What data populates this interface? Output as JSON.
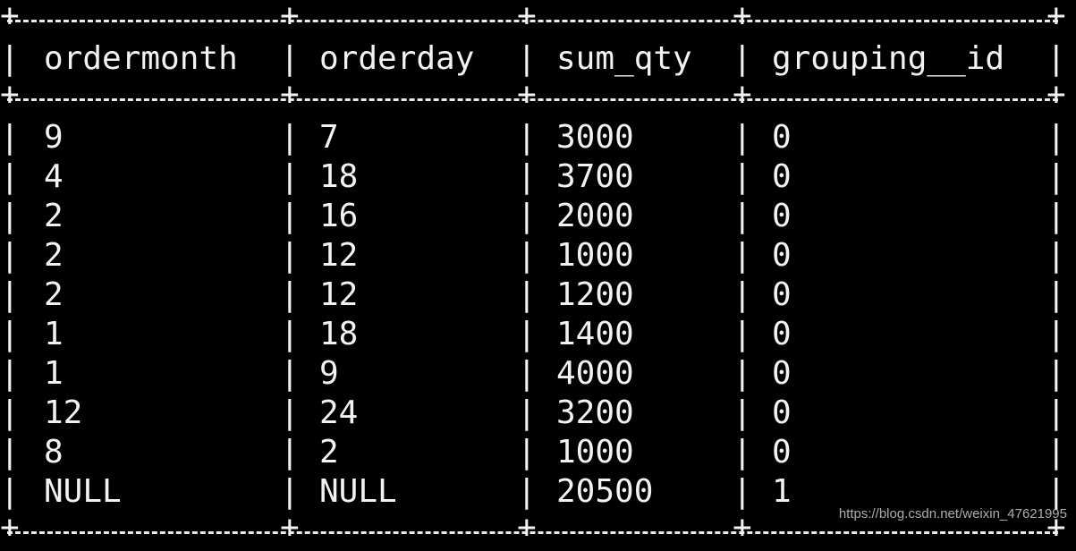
{
  "table": {
    "headers": [
      "ordermonth",
      "orderday",
      "sum_qty",
      "grouping__id"
    ],
    "rows": [
      [
        "9",
        "7",
        "3000",
        "0"
      ],
      [
        "4",
        "18",
        "3700",
        "0"
      ],
      [
        "2",
        "16",
        "2000",
        "0"
      ],
      [
        "2",
        "12",
        "1000",
        "0"
      ],
      [
        "2",
        "12",
        "1200",
        "0"
      ],
      [
        "1",
        "18",
        "1400",
        "0"
      ],
      [
        "1",
        "9",
        "4000",
        "0"
      ],
      [
        "12",
        "24",
        "3200",
        "0"
      ],
      [
        "8",
        "2",
        "1000",
        "0"
      ],
      [
        "NULL",
        "NULL",
        "20500",
        "1"
      ]
    ]
  },
  "watermark": "https://blog.csdn.net/weixin_47621995"
}
